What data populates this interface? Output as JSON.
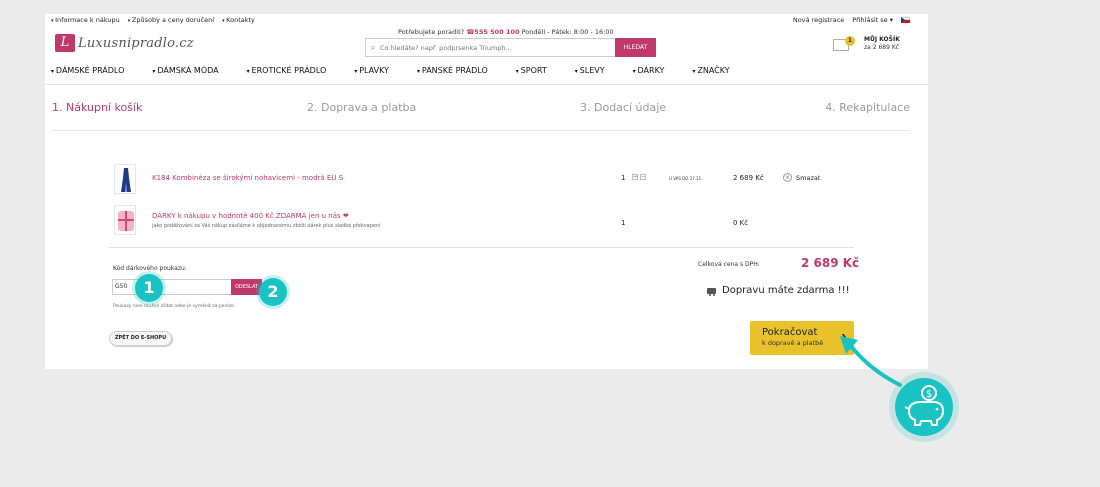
{
  "topbar": {
    "links": [
      "Informace k nákupu",
      "Způsoby a ceny doručení",
      "Kontakty"
    ],
    "register": "Nová registrace",
    "login": "Přihlásit se",
    "help_text": "Potřebujete poradit?",
    "phone": "555 500 100",
    "hours": "Pondělí - Pátek: 8:00 - 16:00"
  },
  "logo": {
    "text": "Luxusnipradlo.cz"
  },
  "search": {
    "placeholder": "Co hledáte? např. podprsenka Triumph...",
    "button": "HLEDAT"
  },
  "cart": {
    "count": "1",
    "title": "MŮJ KOŠÍK",
    "sum": "za 2 689 Kč"
  },
  "nav": [
    "DÁMSKÉ PRÁDLO",
    "DÁMSKÁ MÓDA",
    "EROTICKÉ PRÁDLO",
    "PLAVKY",
    "PÁNSKÉ PRÁDLO",
    "SPORT",
    "SLEVY",
    "DÁRKY",
    "ZNAČKY"
  ],
  "steps": [
    "1. Nákupní košík",
    "2. Doprava a platba",
    "3. Dodací údaje",
    "4. Rekapitulace"
  ],
  "items": [
    {
      "name": "K184 Kombinéza se širokými nohavicemi - modrá EU S",
      "sub": "",
      "qty": "1",
      "delivery": "U VÁS DO 27.11.",
      "price": "2 689 Kč",
      "delete": "Smazat"
    },
    {
      "name": "DÁRKY k nákupu v hodnotě 400 Kč ZDARMA jen u nás ❤",
      "sub": "jako poděkování za Váš nákup zasíláme k objednanému zboží dárek plus sladké překvapení",
      "qty": "1",
      "delivery": "",
      "price": "0 Kč",
      "delete": ""
    }
  ],
  "voucher": {
    "label": "Kód dárkového poukazu:",
    "value": "G50",
    "button": "ODESLAT",
    "note": "Poukazy není možné sčítat nebo je vyměnit za peníze."
  },
  "back_button": "ZPĚT DO E-SHOPU",
  "totals": {
    "label": "Celková cena s DPH:",
    "price": "2 689 Kč",
    "shipping": "Dopravu máte zdarma !!!"
  },
  "continue": {
    "main": "Pokračovat",
    "sub": "k dopravě a platbě"
  },
  "annotations": [
    "1",
    "2"
  ],
  "colors": {
    "brand": "#c0396b",
    "accent": "#e8c12b",
    "annotation": "#1ac3c3"
  }
}
